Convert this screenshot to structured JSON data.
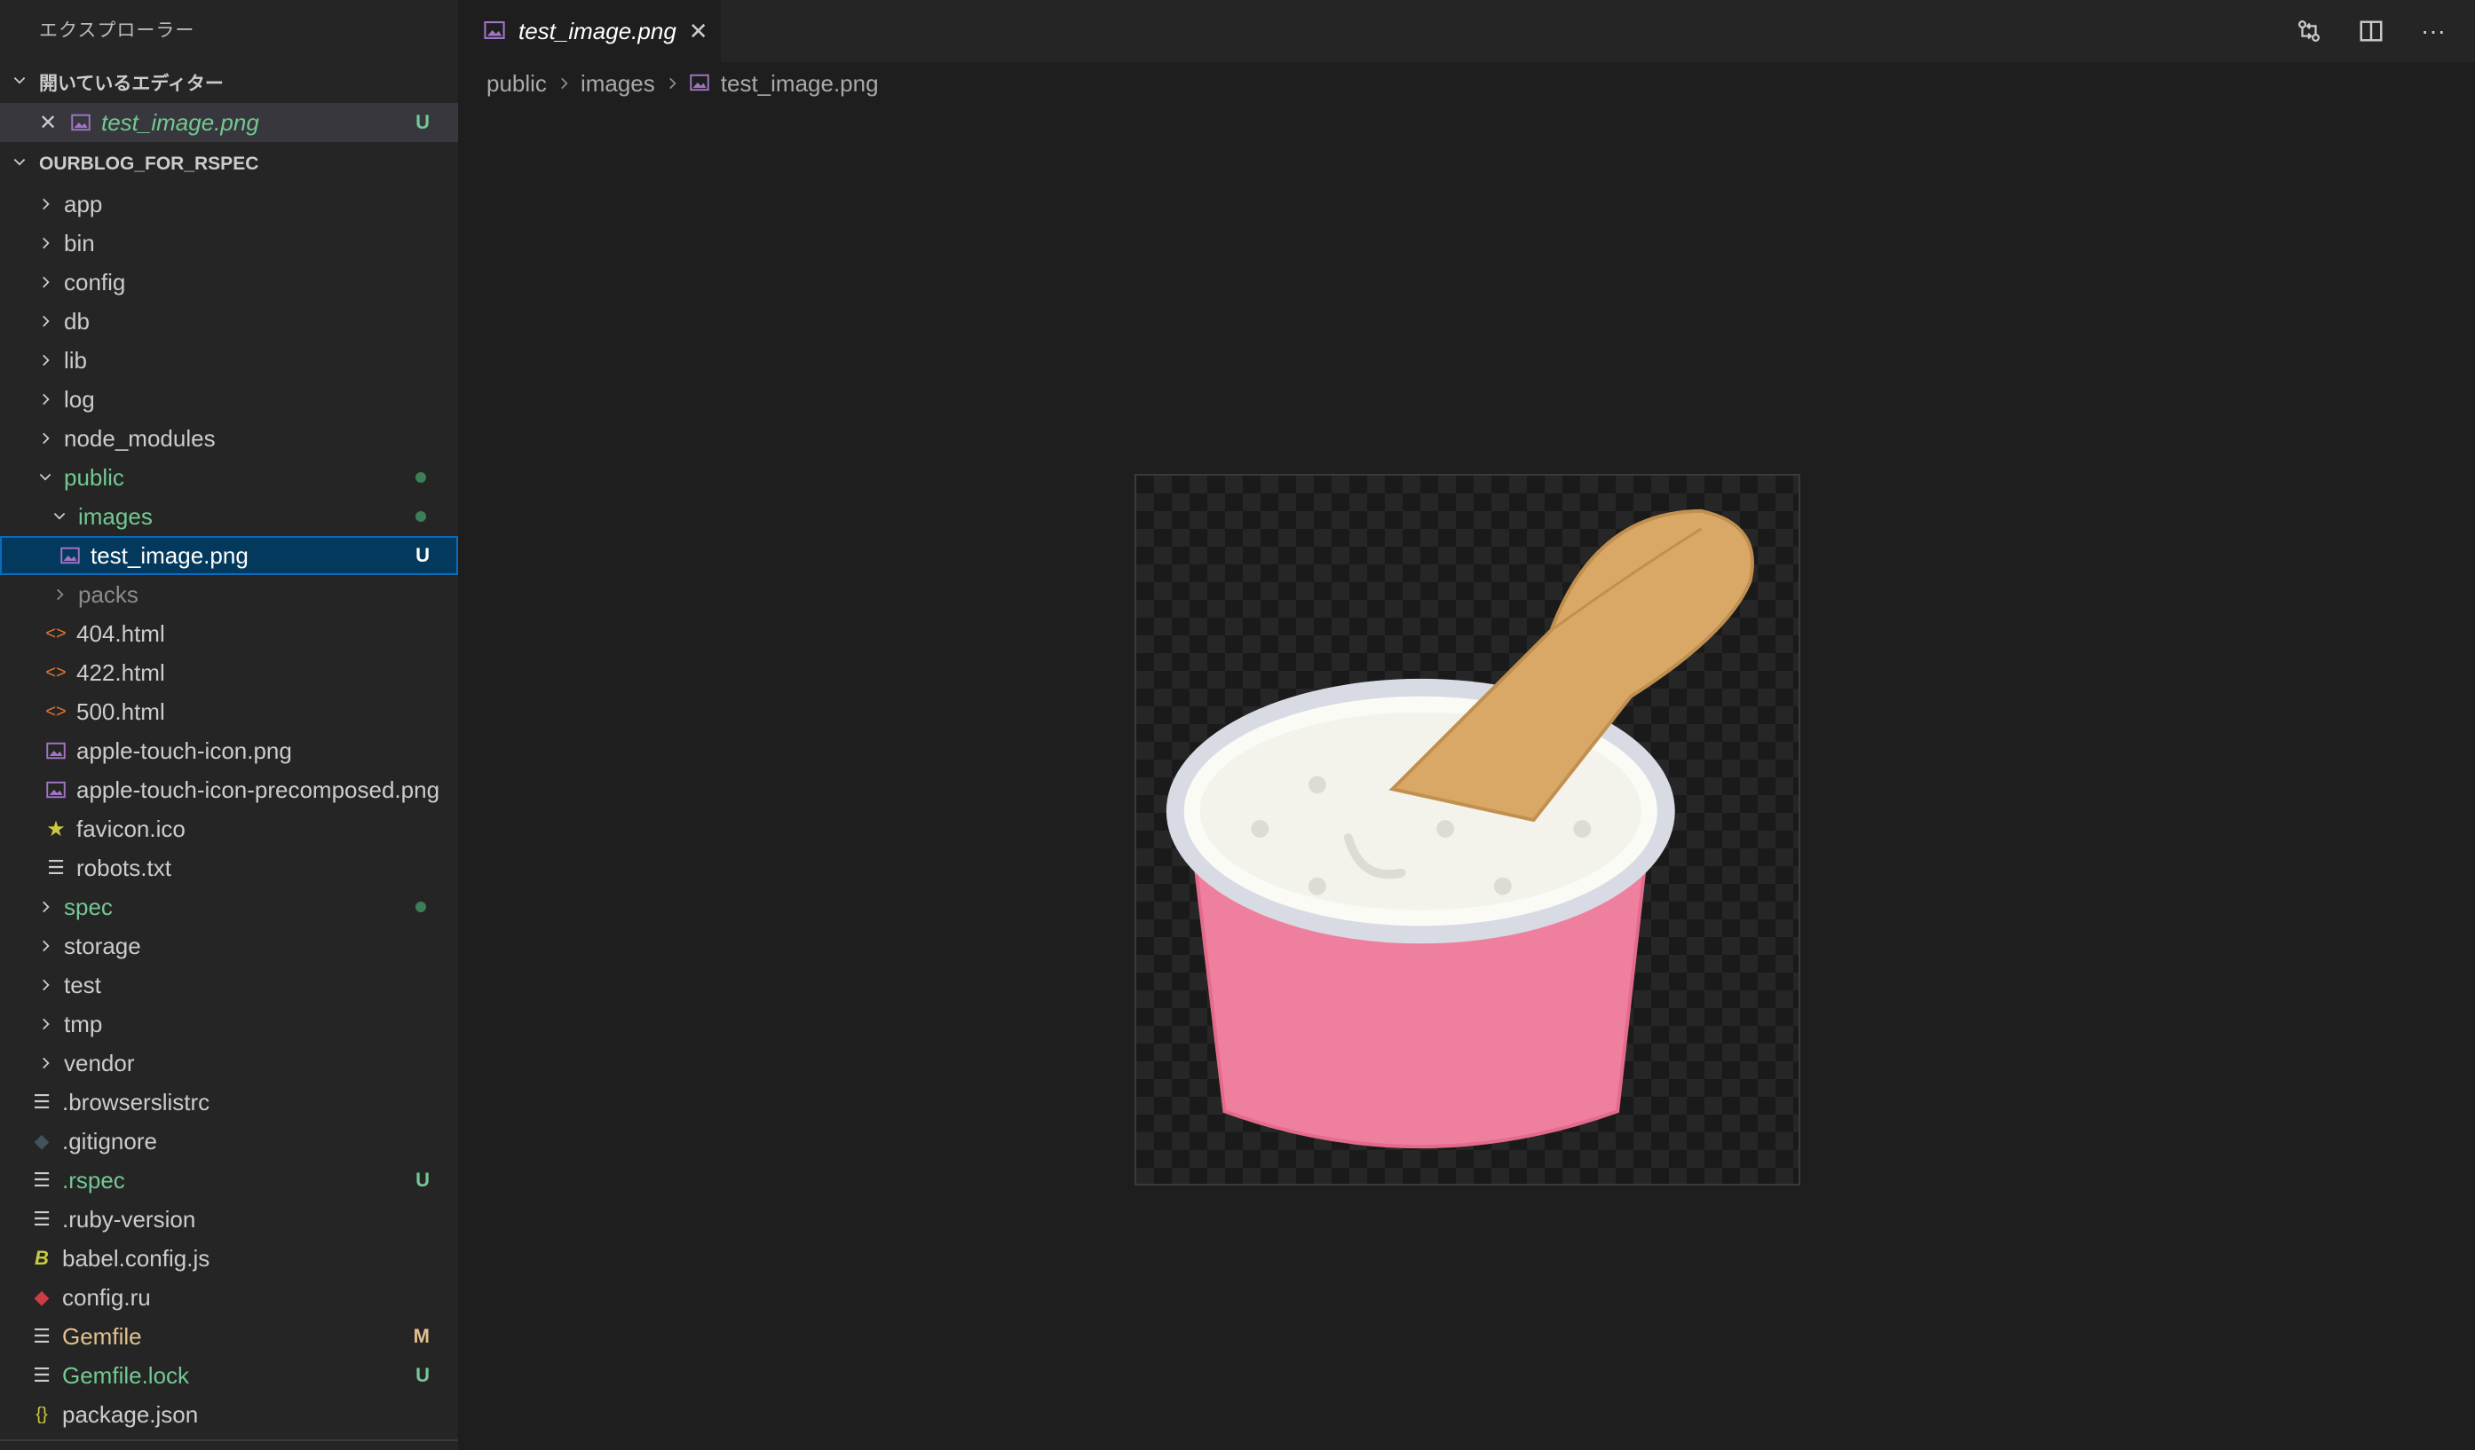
{
  "sidebar": {
    "title": "エクスプローラー",
    "open_editors": {
      "header": "開いているエディター",
      "items": [
        {
          "label": "test_image.png",
          "badge": "U"
        }
      ]
    },
    "project": {
      "header": "OURBLOG_FOR_RSPEC",
      "items": [
        {
          "label": "app"
        },
        {
          "label": "bin"
        },
        {
          "label": "config"
        },
        {
          "label": "db"
        },
        {
          "label": "lib"
        },
        {
          "label": "log"
        },
        {
          "label": "node_modules"
        },
        {
          "label": "public"
        },
        {
          "label": "images"
        },
        {
          "label": "test_image.png",
          "badge": "U"
        },
        {
          "label": "packs"
        },
        {
          "label": "404.html"
        },
        {
          "label": "422.html"
        },
        {
          "label": "500.html"
        },
        {
          "label": "apple-touch-icon.png"
        },
        {
          "label": "apple-touch-icon-precomposed.png"
        },
        {
          "label": "favicon.ico"
        },
        {
          "label": "robots.txt"
        },
        {
          "label": "spec"
        },
        {
          "label": "storage"
        },
        {
          "label": "test"
        },
        {
          "label": "tmp"
        },
        {
          "label": "vendor"
        },
        {
          "label": ".browserslistrc"
        },
        {
          "label": ".gitignore"
        },
        {
          "label": ".rspec",
          "badge": "U"
        },
        {
          "label": ".ruby-version"
        },
        {
          "label": "babel.config.js"
        },
        {
          "label": "config.ru"
        },
        {
          "label": "Gemfile",
          "badge": "M"
        },
        {
          "label": "Gemfile.lock",
          "badge": "U"
        },
        {
          "label": "package.json"
        }
      ]
    }
  },
  "editor": {
    "tab": {
      "label": "test_image.png",
      "close_icon": "close-icon"
    },
    "actions": [
      "compare-changes-icon",
      "split-editor-icon",
      "more-actions-icon"
    ],
    "breadcrumb": [
      "public",
      "images",
      "test_image.png"
    ]
  },
  "colors": {
    "sidebar_bg": "#252526",
    "editor_bg": "#1e1e1e",
    "selection_bg": "#04395e",
    "untracked_green": "#73c991",
    "modified_yellow": "#e2c08d",
    "image_file_icon": "#a074c4"
  }
}
